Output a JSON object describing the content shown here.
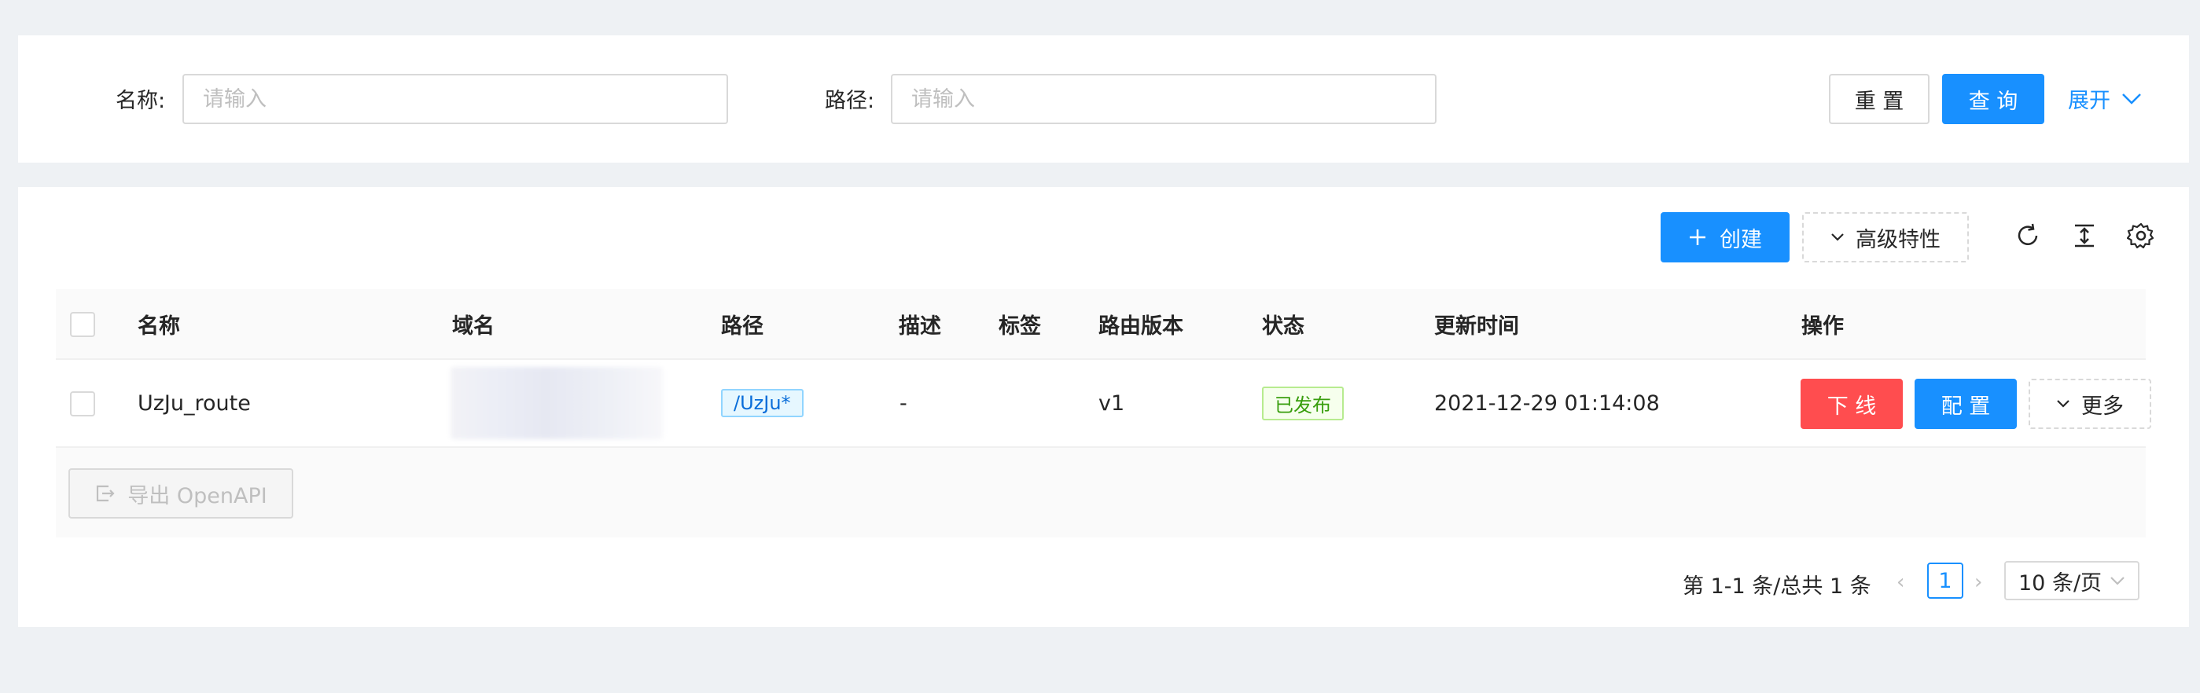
{
  "search": {
    "name_label": "名称:",
    "name_placeholder": "请输入",
    "path_label": "路径:",
    "path_placeholder": "请输入",
    "reset_label": "重 置",
    "query_label": "查 询",
    "expand_label": "展开"
  },
  "toolbar": {
    "create_label": "创建",
    "advanced_label": "高级特性"
  },
  "table": {
    "columns": [
      "名称",
      "域名",
      "路径",
      "描述",
      "标签",
      "路由版本",
      "状态",
      "更新时间",
      "操作"
    ],
    "rows": [
      {
        "name": "UzJu_route",
        "path": "/UzJu*",
        "description": "-",
        "version": "v1",
        "status": "已发布",
        "updated": "2021-12-29 01:14:08",
        "actions": {
          "offline": "下 线",
          "configure": "配 置",
          "more": "更多"
        }
      }
    ],
    "export_label": "导出 OpenAPI"
  },
  "pagination": {
    "summary": "第 1-1 条/总共 1 条",
    "current_page": "1",
    "page_size": "10 条/页"
  },
  "colors": {
    "primary": "#1890ff",
    "danger": "#ff4d4f",
    "success": "#389e0d",
    "background": "#eef1f4"
  }
}
